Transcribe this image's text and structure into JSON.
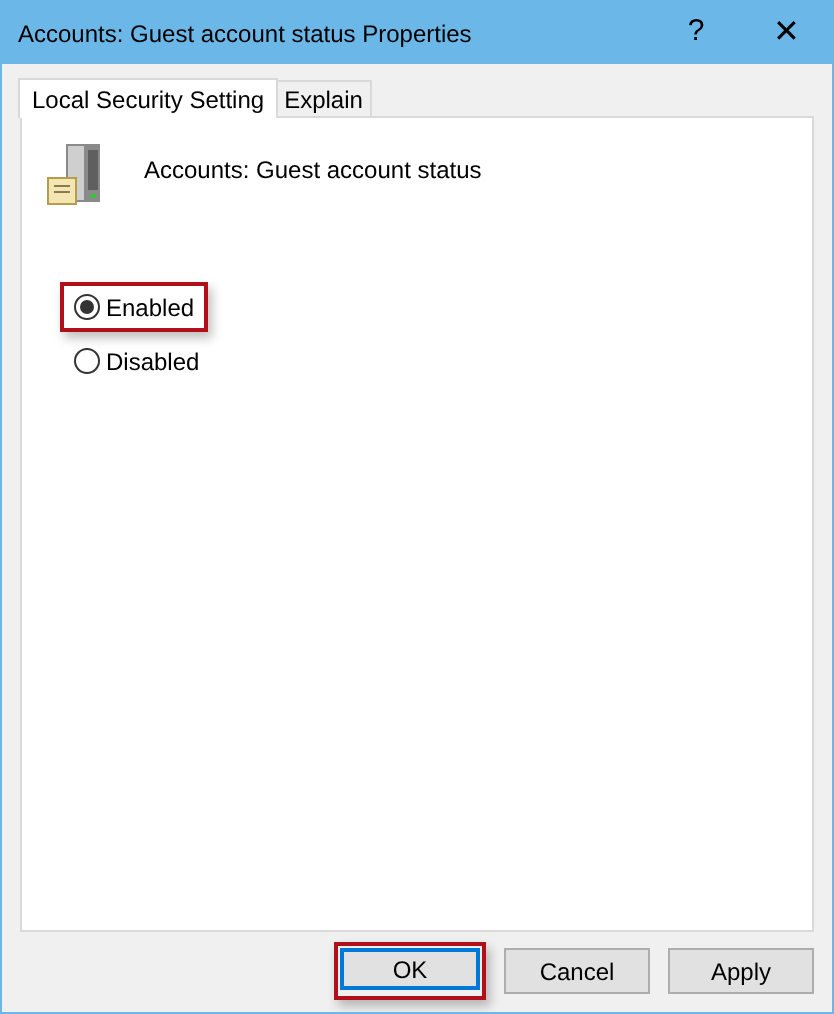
{
  "window": {
    "title": "Accounts: Guest account status Properties",
    "help": "?",
    "close": "✕"
  },
  "tabs": [
    {
      "label": "Local Security Setting",
      "selected": true
    },
    {
      "label": "Explain",
      "selected": false
    }
  ],
  "policy": {
    "name": "Accounts: Guest account status"
  },
  "options": [
    {
      "label": "Enabled",
      "selected": true,
      "highlighted": true
    },
    {
      "label": "Disabled",
      "selected": false,
      "highlighted": false
    }
  ],
  "buttons": [
    {
      "label": "OK",
      "default": true,
      "highlighted": true
    },
    {
      "label": "Cancel",
      "default": false,
      "highlighted": false
    },
    {
      "label": "Apply",
      "default": false,
      "highlighted": false
    }
  ]
}
